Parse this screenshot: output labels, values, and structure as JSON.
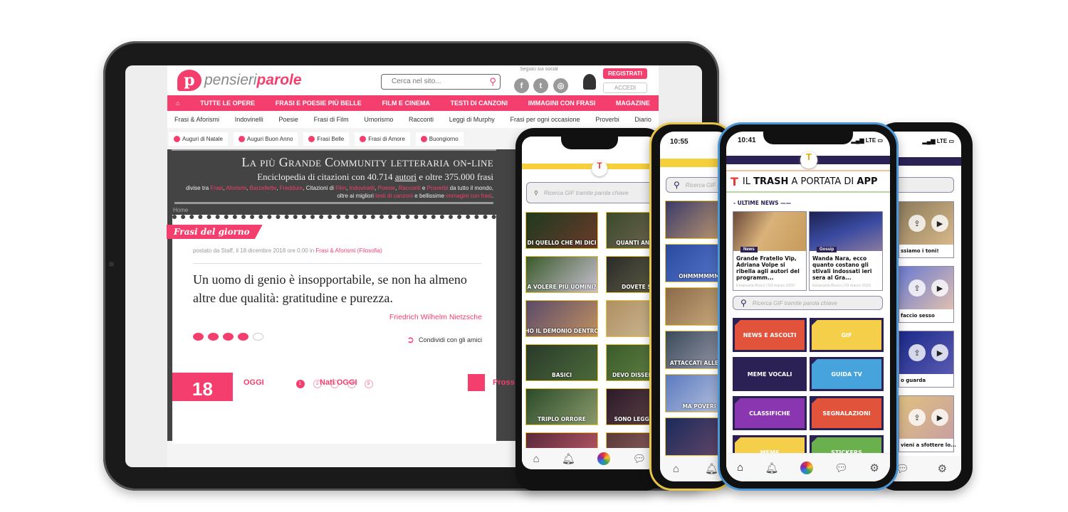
{
  "site": {
    "logo": {
      "part1": "pensieri",
      "part2": "parole"
    },
    "search_placeholder": "Cerca nel sito...",
    "social_label": "Seguici sui social",
    "social": [
      "f",
      "t",
      "ig"
    ],
    "register": "REGISTRATI",
    "login": "ACCEDI",
    "nav": [
      "TUTTE LE OPERE",
      "FRASI E POESIE PIÙ BELLE",
      "FILM E CINEMA",
      "TESTI DI CANZONI",
      "IMMAGINI CON FRASI",
      "MAGAZINE"
    ],
    "subnav": [
      "Frasi & Aforismi",
      "Indovinelli",
      "Poesie",
      "Frasi di Film",
      "Umorismo",
      "Racconti",
      "Leggi di Murphy",
      "Frasi per ogni occasione",
      "Proverbi",
      "Diario"
    ],
    "tags": [
      "Auguri di Natale",
      "Auguri Buon Anno",
      "Frasi Belle",
      "Frasi di Amore",
      "Buongiorno"
    ],
    "banner": {
      "title": "La più Grande Community letteraria on-line",
      "line2_a": "Enciclopedia di citazioni con 40.714 ",
      "line2_link": "autori",
      "line2_b": " e oltre 375.000 frasi",
      "line3": [
        [
          "divise tra ",
          0
        ],
        [
          "Frasi",
          1
        ],
        [
          ", ",
          0
        ],
        [
          "Aforismi",
          1
        ],
        [
          ", ",
          0
        ],
        [
          "Barzellette",
          1
        ],
        [
          ", ",
          0
        ],
        [
          "Freddure",
          1
        ],
        [
          ", Citazioni di ",
          0
        ],
        [
          "Film",
          1
        ],
        [
          ", ",
          0
        ],
        [
          "Indovinelli",
          1
        ],
        [
          ", ",
          0
        ],
        [
          "Poesie",
          1
        ],
        [
          ", ",
          0
        ],
        [
          "Racconti",
          1
        ],
        [
          " e ",
          0
        ],
        [
          "Proverbi",
          1
        ],
        [
          " da tutto il mondo, oltre ai migliori ",
          0
        ],
        [
          "testi di canzoni",
          1
        ],
        [
          " e bellissime ",
          0
        ],
        [
          "immagini con frasi",
          1
        ],
        [
          ".",
          0
        ]
      ]
    },
    "breadcrumb": "Home",
    "section": "Frasi del giorno",
    "meta": "postato da Staff, il 18 dicembre 2018 ore 0.00 in ",
    "meta_cat": "Frasi & Aforismi",
    "meta_sub": "(Filosofia)",
    "quote": "Un uomo di genio è insopportabile, se non ha almeno altre due qualità: gratitudine e purezza.",
    "author": "Friedrich Wilhelm Nietzsche",
    "rating": 4,
    "rating_max": 5,
    "share": "Condividi con gli amici",
    "pages": [
      "1",
      "2",
      "3",
      "4",
      "5"
    ],
    "current_page": "1",
    "footer": {
      "day": "18",
      "today": "OGGI",
      "born": "Nati OGGI",
      "next": "Pross"
    },
    "accent": "#f43f6e"
  },
  "phone_android": {
    "search": "Ricerca GIF tramite parola chiave",
    "gifs": [
      "DI QUELLO CHE MI DICI",
      "QUANTI ANNI HAI",
      "A VOLERE PIÙ UOMINI?",
      "DOVETE STAR",
      "HO IL DEMONIO DENTRO",
      "",
      "BASICI",
      "DEVO DISSENTIRE A",
      "TRIPLO ORRORE",
      "SONO LEGGERMEN",
      "",
      ""
    ],
    "accent": "#f6cf3d"
  },
  "phone_yellow": {
    "time": "10:55",
    "search": "Ricerca GIF tra",
    "gifs": [
      "",
      "OHMMMMMM",
      "",
      "ATTACCATI ALLE SU",
      "MA POVERI",
      ""
    ]
  },
  "phone_main": {
    "time": "10:41",
    "network": "LTE",
    "banner": {
      "a": "IL ",
      "b": "TRASH",
      "c": " A PORTATA DI ",
      "d": "APP"
    },
    "section": "- ULTIME NEWS",
    "news": [
      {
        "badge": "News",
        "title": "Grande Fratello Vip, Adriana Volpe si ribella agli autori del programm...",
        "meta": "Emanuela Bruco | 03 marzo 2020"
      },
      {
        "badge": "Gossip",
        "title": "Wanda Nara, ecco quanto costano gli stivali indossati ieri sera al Gra...",
        "meta": "Emanuela Bruco | 03 marzo 2020"
      }
    ],
    "search": "Ricerca GIF tramite parola chiave",
    "tiles": [
      {
        "label": "NEWS E ASCOLTI",
        "color": "#e2533c"
      },
      {
        "label": "GIF",
        "color": "#f6cf4a"
      },
      {
        "label": "MEME VOCALI",
        "color": "#2b2155"
      },
      {
        "label": "GUIDA TV",
        "color": "#46a3dc"
      },
      {
        "label": "CLASSIFICHE",
        "color": "#8a36b0"
      },
      {
        "label": "SEGNALAZIONI",
        "color": "#e2533c"
      },
      {
        "label": "MEME",
        "color": "#f6cf4a"
      },
      {
        "label": "STICKERS",
        "color": "#6ab04c"
      }
    ],
    "brand": "#2b2155"
  },
  "phone_back": {
    "network": "LTE",
    "videos": [
      "ssiamo i toni!",
      "faccio sesso",
      "o guarda",
      "vieni a sfottere lo..."
    ]
  }
}
